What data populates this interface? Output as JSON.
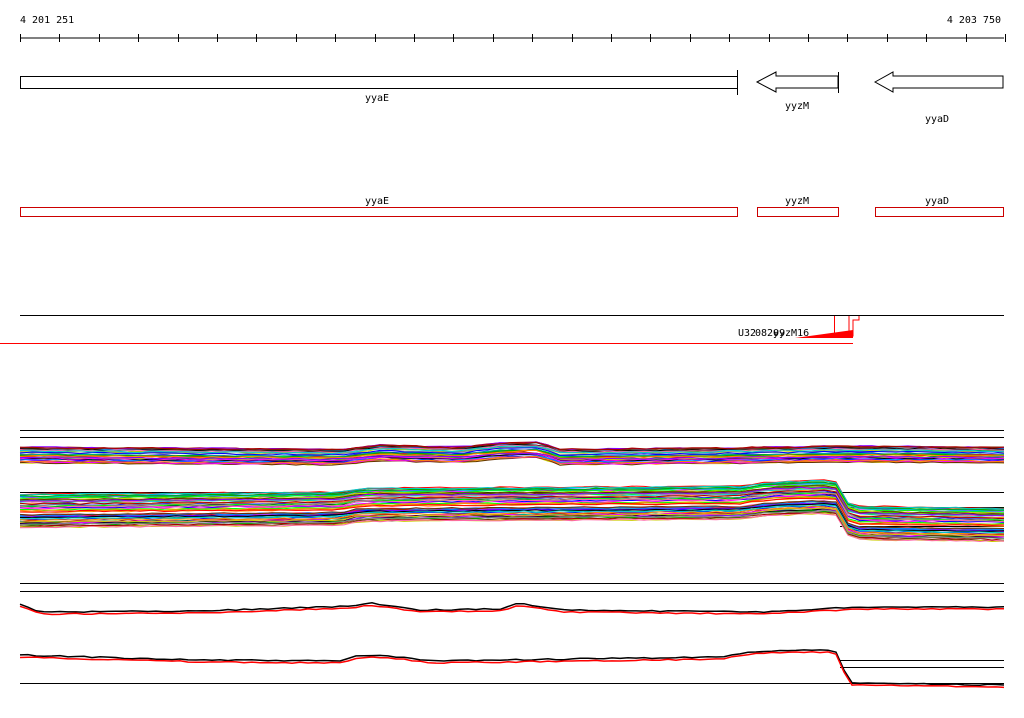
{
  "ruler": {
    "start_label": "4 201 251",
    "end_label": "4 203 750"
  },
  "genes": [
    {
      "name": "yyaE",
      "type": "forward-box"
    },
    {
      "name": "yyzM",
      "type": "reverse-arrow"
    },
    {
      "name": "yyaD",
      "type": "reverse-arrow"
    }
  ],
  "annotations": [
    {
      "name": "yyaE"
    },
    {
      "name": "yyzM"
    },
    {
      "name": "yyaD"
    }
  ],
  "features": {
    "labels": [
      "U32",
      "08209",
      "yyzM16"
    ]
  },
  "colors": {
    "gene_outline": "#000000",
    "annotation_outline": "#cc0000",
    "red_track": "#ff0000",
    "black_track": "#000000"
  }
}
